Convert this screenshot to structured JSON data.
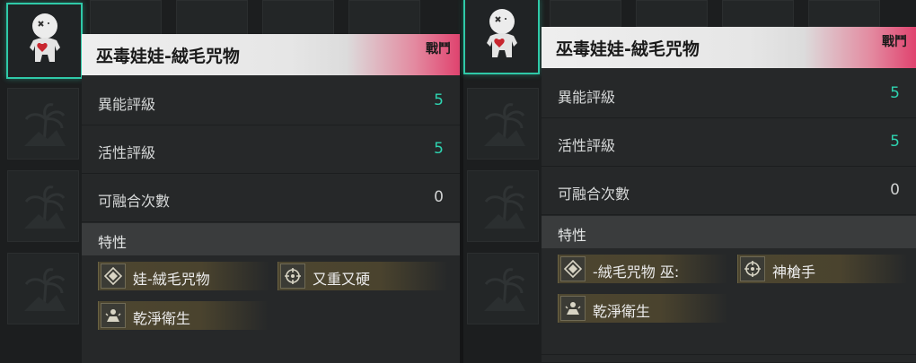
{
  "left_card": {
    "title": "巫毒娃娃-絨毛咒物",
    "tag": "戰鬥",
    "stats": [
      {
        "label": "異能評級",
        "value": "5"
      },
      {
        "label": "活性評級",
        "value": "5"
      },
      {
        "label": "可融合次數",
        "value": "0"
      }
    ],
    "traits_header": "特性",
    "traits": [
      {
        "label": "娃-絨毛咒物",
        "icon": "diamond-icon"
      },
      {
        "label": "又重又硬",
        "icon": "crosshair-icon"
      },
      {
        "label": "乾淨衛生",
        "icon": "clean-icon"
      }
    ]
  },
  "right_card": {
    "title": "巫毒娃娃-絨毛咒物",
    "tag": "戰鬥",
    "stats": [
      {
        "label": "異能評級",
        "value": "5"
      },
      {
        "label": "活性評級",
        "value": "5"
      },
      {
        "label": "可融合次數",
        "value": "0"
      }
    ],
    "traits_header": "特性",
    "traits": [
      {
        "label": "-絨毛咒物   巫:",
        "icon": "diamond-icon"
      },
      {
        "label": "神槍手",
        "icon": "crosshair-icon"
      },
      {
        "label": "乾淨衛生",
        "icon": "clean-icon"
      }
    ]
  },
  "colors": {
    "accent": "#2fc9a8",
    "tag_pink": "#e0436f",
    "trait_gold": "#4d4630"
  }
}
